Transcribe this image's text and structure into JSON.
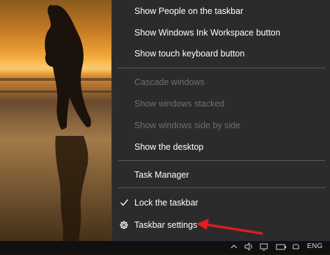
{
  "menu": {
    "items": [
      {
        "label": "Show People on the taskbar",
        "enabled": true
      },
      {
        "label": "Show Windows Ink Workspace button",
        "enabled": true
      },
      {
        "label": "Show touch keyboard button",
        "enabled": true
      },
      {
        "label": "Cascade windows",
        "enabled": false
      },
      {
        "label": "Show windows stacked",
        "enabled": false
      },
      {
        "label": "Show windows side by side",
        "enabled": false
      },
      {
        "label": "Show the desktop",
        "enabled": true
      },
      {
        "label": "Task Manager",
        "enabled": true
      },
      {
        "label": "Lock the taskbar",
        "enabled": true,
        "checked": true,
        "icon": "checkmark-icon"
      },
      {
        "label": "Taskbar settings",
        "enabled": true,
        "icon": "gear-icon"
      }
    ]
  },
  "tray": {
    "language": "ENG",
    "icons": [
      "chevron-up-icon",
      "network-icon",
      "speaker-icon",
      "battery-icon",
      "notification-icon"
    ]
  },
  "annotation": {
    "type": "red-arrow",
    "color": "#d8201c",
    "target": "Taskbar settings"
  },
  "colors": {
    "menu_bg": "#2b2b2b",
    "text": "#ffffff",
    "disabled_text": "#6f6f6f",
    "separator": "#5a5a5a"
  }
}
